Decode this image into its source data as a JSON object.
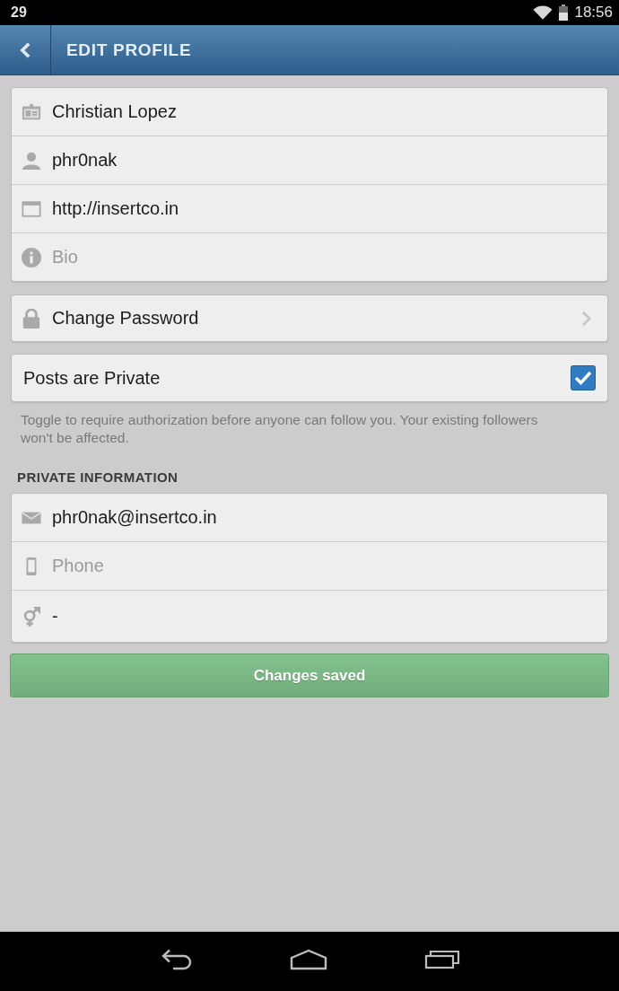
{
  "status_bar": {
    "notification": "29",
    "time": "18:56"
  },
  "app_bar": {
    "title": "EDIT PROFILE"
  },
  "profile_fields": [
    {
      "kind": "name",
      "value": "Christian Lopez"
    },
    {
      "kind": "username",
      "value": "phr0nak"
    },
    {
      "kind": "website",
      "value": "http://insertco.in"
    },
    {
      "kind": "bio",
      "placeholder": "Bio"
    }
  ],
  "change_password": {
    "label": "Change Password"
  },
  "private_posts": {
    "label": "Posts are Private",
    "checked": true,
    "help": "Toggle to require authorization before anyone can follow you. Your existing followers won't be affected."
  },
  "private_information": {
    "heading": "PRIVATE INFORMATION",
    "fields": [
      {
        "kind": "email",
        "value": "phr0nak@insertco.in"
      },
      {
        "kind": "phone",
        "placeholder": "Phone"
      },
      {
        "kind": "gender",
        "value": "-"
      }
    ]
  },
  "save_button": {
    "label": "Changes saved"
  }
}
